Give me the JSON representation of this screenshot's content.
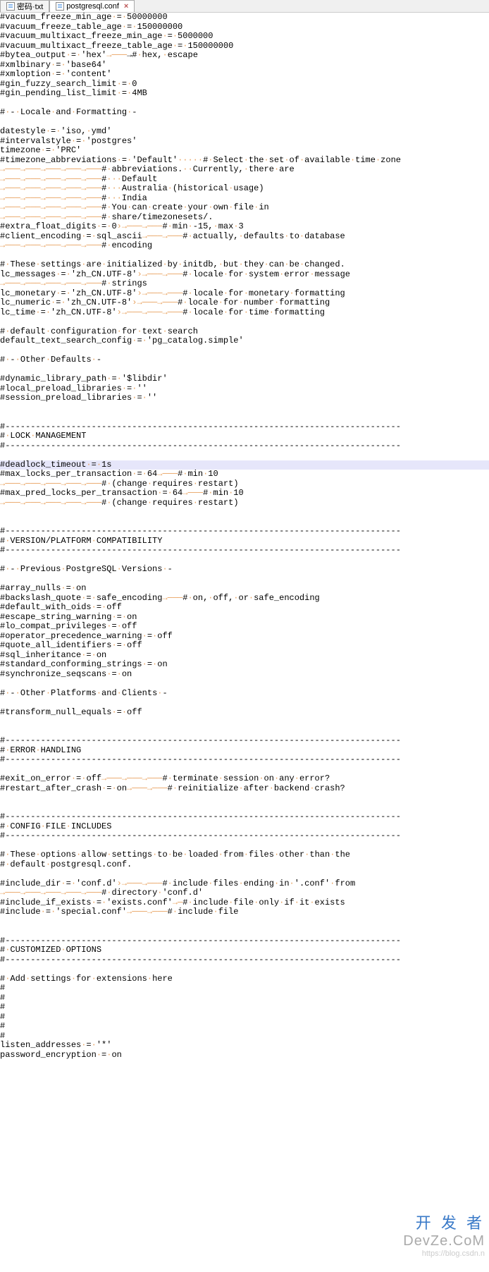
{
  "tabs": [
    {
      "label": "密码·txt",
      "active": false
    },
    {
      "label": "postgresql.conf",
      "active": true
    }
  ],
  "watermark": {
    "big": "开 发 者",
    "url": "DevZe.CoM",
    "blog": "https://blog.csdn.n"
  },
  "lines": [
    {
      "t": "#vacuum_freeze_min_age·=·50000000"
    },
    {
      "t": "#vacuum_freeze_table_age·=·150000000"
    },
    {
      "t": "#vacuum_multixact_freeze_min_age·=·5000000"
    },
    {
      "t": "#vacuum_multixact_freeze_table_age·=·150000000"
    },
    {
      "t": "#bytea_output·=·'hex'→───→#·hex,·escape"
    },
    {
      "t": "#xmlbinary·=·'base64'"
    },
    {
      "t": "#xmloption·=·'content'"
    },
    {
      "t": "#gin_fuzzy_search_limit·=·0"
    },
    {
      "t": "#gin_pending_list_limit·=·4MB"
    },
    {
      "t": ""
    },
    {
      "t": "#·-·Locale·and·Formatting·-"
    },
    {
      "t": ""
    },
    {
      "t": "datestyle·=·'iso,·ymd'"
    },
    {
      "t": "#intervalstyle·=·'postgres'"
    },
    {
      "t": "timezone·=·'PRC'"
    },
    {
      "t": "#timezone_abbreviations·=·'Default'·····#·Select·the·set·of·available·time·zone"
    },
    {
      "t": "→───→───→───→───→───#·abbreviations.··Currently,·there·are"
    },
    {
      "t": "→───→───→───→───→───#···Default"
    },
    {
      "t": "→───→───→───→───→───#···Australia·(historical·usage)"
    },
    {
      "t": "→───→───→───→───→───#···India"
    },
    {
      "t": "→───→───→───→───→───#·You·can·create·your·own·file·in"
    },
    {
      "t": "→───→───→───→───→───#·share/timezonesets/."
    },
    {
      "t": "#extra_float_digits·=·0›→───→───#·min·-15,·max·3"
    },
    {
      "t": "#client_encoding·=·sql_ascii→───→───#·actually,·defaults·to·database"
    },
    {
      "t": "→───→───→───→───→───#·encoding"
    },
    {
      "t": ""
    },
    {
      "t": "#·These·settings·are·initialized·by·initdb,·but·they·can·be·changed."
    },
    {
      "t": "lc_messages·=·'zh_CN.UTF-8'›→───→───#·locale·for·system·error·message"
    },
    {
      "t": "→───→───→───→───→───#·strings"
    },
    {
      "t": "lc_monetary·=·'zh_CN.UTF-8'›→───→───#·locale·for·monetary·formatting"
    },
    {
      "t": "lc_numeric·=·'zh_CN.UTF-8'›→───→───#·locale·for·number·formatting"
    },
    {
      "t": "lc_time·=·'zh_CN.UTF-8'›→───→───→───#·locale·for·time·formatting"
    },
    {
      "t": ""
    },
    {
      "t": "#·default·configuration·for·text·search"
    },
    {
      "t": "default_text_search_config·=·'pg_catalog.simple'"
    },
    {
      "t": ""
    },
    {
      "t": "#·-·Other·Defaults·-"
    },
    {
      "t": ""
    },
    {
      "t": "#dynamic_library_path·=·'$libdir'"
    },
    {
      "t": "#local_preload_libraries·=·''"
    },
    {
      "t": "#session_preload_libraries·=·''"
    },
    {
      "t": ""
    },
    {
      "t": ""
    },
    {
      "t": "#------------------------------------------------------------------------------"
    },
    {
      "t": "#·LOCK·MANAGEMENT"
    },
    {
      "t": "#------------------------------------------------------------------------------"
    },
    {
      "t": ""
    },
    {
      "t": "#deadlock_timeout·=·1s",
      "hl": true
    },
    {
      "t": "#max_locks_per_transaction·=·64→───#·min·10"
    },
    {
      "t": "→───→───→───→───→───#·(change·requires·restart)"
    },
    {
      "t": "#max_pred_locks_per_transaction·=·64→───#·min·10"
    },
    {
      "t": "→───→───→───→───→───#·(change·requires·restart)"
    },
    {
      "t": ""
    },
    {
      "t": ""
    },
    {
      "t": "#------------------------------------------------------------------------------"
    },
    {
      "t": "#·VERSION/PLATFORM·COMPATIBILITY"
    },
    {
      "t": "#------------------------------------------------------------------------------"
    },
    {
      "t": ""
    },
    {
      "t": "#·-·Previous·PostgreSQL·Versions·-"
    },
    {
      "t": ""
    },
    {
      "t": "#array_nulls·=·on"
    },
    {
      "t": "#backslash_quote·=·safe_encoding→───#·on,·off,·or·safe_encoding"
    },
    {
      "t": "#default_with_oids·=·off"
    },
    {
      "t": "#escape_string_warning·=·on"
    },
    {
      "t": "#lo_compat_privileges·=·off"
    },
    {
      "t": "#operator_precedence_warning·=·off"
    },
    {
      "t": "#quote_all_identifiers·=·off"
    },
    {
      "t": "#sql_inheritance·=·on"
    },
    {
      "t": "#standard_conforming_strings·=·on"
    },
    {
      "t": "#synchronize_seqscans·=·on"
    },
    {
      "t": ""
    },
    {
      "t": "#·-·Other·Platforms·and·Clients·-"
    },
    {
      "t": ""
    },
    {
      "t": "#transform_null_equals·=·off"
    },
    {
      "t": ""
    },
    {
      "t": ""
    },
    {
      "t": "#------------------------------------------------------------------------------"
    },
    {
      "t": "#·ERROR·HANDLING"
    },
    {
      "t": "#------------------------------------------------------------------------------"
    },
    {
      "t": ""
    },
    {
      "t": "#exit_on_error·=·off→───→───→───#·terminate·session·on·any·error?"
    },
    {
      "t": "#restart_after_crash·=·on→───→───#·reinitialize·after·backend·crash?"
    },
    {
      "t": ""
    },
    {
      "t": ""
    },
    {
      "t": "#------------------------------------------------------------------------------"
    },
    {
      "t": "#·CONFIG·FILE·INCLUDES"
    },
    {
      "t": "#------------------------------------------------------------------------------"
    },
    {
      "t": ""
    },
    {
      "t": "#·These·options·allow·settings·to·be·loaded·from·files·other·than·the"
    },
    {
      "t": "#·default·postgresql.conf."
    },
    {
      "t": ""
    },
    {
      "t": "#include_dir·=·'conf.d'›→───→───#·include·files·ending·in·'.conf'·from"
    },
    {
      "t": "→───→───→───→───→───#·directory·'conf.d'"
    },
    {
      "t": "#include_if_exists·=·'exists.conf'→─#·include·file·only·if·it·exists"
    },
    {
      "t": "#include·=·'special.conf'→───→───#·include·file"
    },
    {
      "t": ""
    },
    {
      "t": ""
    },
    {
      "t": "#------------------------------------------------------------------------------"
    },
    {
      "t": "#·CUSTOMIZED·OPTIONS"
    },
    {
      "t": "#------------------------------------------------------------------------------"
    },
    {
      "t": ""
    },
    {
      "t": "#·Add·settings·for·extensions·here"
    },
    {
      "t": "#"
    },
    {
      "t": "#"
    },
    {
      "t": "#"
    },
    {
      "t": "#"
    },
    {
      "t": "#"
    },
    {
      "t": "#"
    },
    {
      "t": "listen_addresses·=·'*'"
    },
    {
      "t": "password_encryption·=·on"
    },
    {
      "t": ""
    }
  ]
}
